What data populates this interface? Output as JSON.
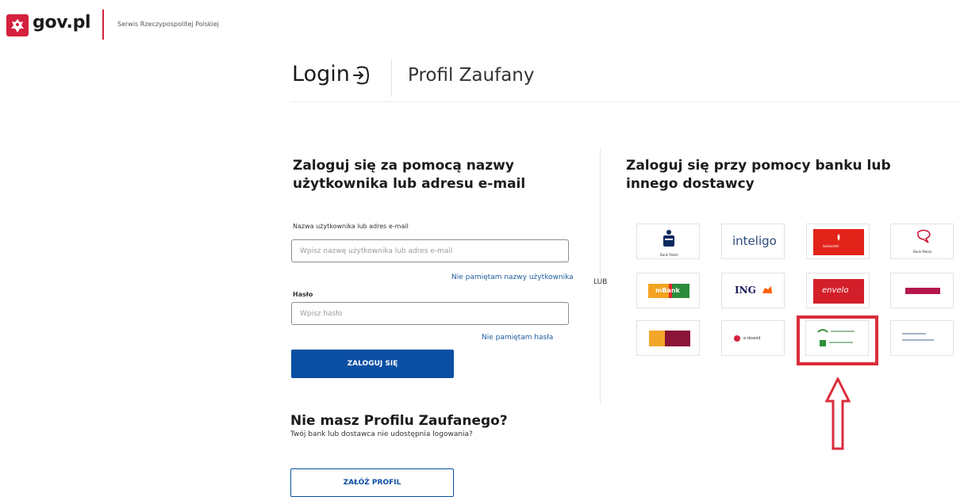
{
  "header": {
    "logo_text": "gov.pl",
    "subtitle": "Serwis Rzeczypospolitej Polskiej"
  },
  "tabs": {
    "login": "Login",
    "profile": "Profil Zaufany"
  },
  "username_login": {
    "heading": "Zaloguj się za pomocą nazwy użytkownika lub adresu e-mail",
    "username_label": "Nazwa użytkownika lub adres e-mail",
    "username_placeholder": "Wpisz nazwę użytkownika lub adres e-mail",
    "forgot_username": "Nie pamiętam nazwy użytkownika",
    "password_label": "Hasło",
    "password_placeholder": "Wpisz hasło",
    "forgot_password": "Nie pamiętam hasła",
    "login_button": "ZALOGUJ SIĘ"
  },
  "no_profile": {
    "heading": "Nie masz Profilu Zaufanego?",
    "subtext": "Twój bank lub dostawca nie udostępnia logowania?",
    "create_button": "ZAŁÓŻ PROFIL"
  },
  "separator": "LUB",
  "bank_login": {
    "heading": "Zaloguj się przy pomocy banku lub innego dostawcy",
    "providers": [
      {
        "name": "PKO Bank Polski",
        "caption": "Bank Polski",
        "icon": "pko-logo"
      },
      {
        "name": "Inteligo",
        "caption": "inteligo",
        "icon": "inteligo-logo"
      },
      {
        "name": "Santander",
        "caption": "Santander",
        "icon": "santander-logo"
      },
      {
        "name": "Bank Pekao",
        "caption": "Bank Pekao",
        "icon": "pekao-logo"
      },
      {
        "name": "mBank",
        "caption": "mBank",
        "icon": "mbank-logo"
      },
      {
        "name": "ING",
        "caption": "ING",
        "icon": "ing-logo"
      },
      {
        "name": "Envelo",
        "caption": "envelo",
        "icon": "envelo-logo"
      },
      {
        "name": "Millennium",
        "caption": "",
        "icon": "millennium-logo"
      },
      {
        "name": "Alior",
        "caption": "",
        "icon": "alior-logo"
      },
      {
        "name": "e-dowód",
        "caption": "e-dowód",
        "icon": "edowod-logo"
      },
      {
        "name": "Bank Spółdzielczy",
        "caption": "",
        "icon": "bank-spoldzielczy-logo"
      },
      {
        "name": "Cooperative bank",
        "caption": "",
        "icon": "cooperative-bank-logo"
      }
    ]
  },
  "annotation": {
    "highlight_color": "#d92d3c",
    "arrow_icon": "up-arrow-icon"
  },
  "colors": {
    "brand_red": "#d4213d",
    "primary_blue": "#0b4fa3",
    "link_blue": "#1b5a9c"
  }
}
